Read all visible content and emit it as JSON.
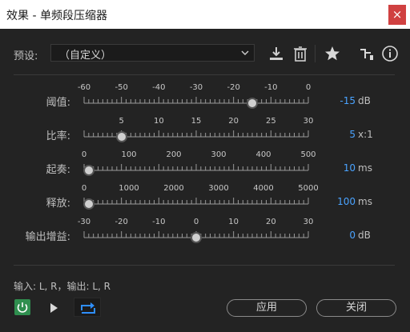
{
  "window": {
    "title": "效果 - 单频段压缩器",
    "close_glyph": "×"
  },
  "preset": {
    "label": "预设:",
    "value": "（自定义）"
  },
  "toolbar": {
    "icons": [
      "download-icon",
      "trash-icon",
      "star-icon",
      "route-icon",
      "info-icon"
    ]
  },
  "controls": [
    {
      "label": "阈值:",
      "ticks": [
        "-60",
        "-50",
        "-40",
        "-30",
        "-20",
        "-10",
        "0"
      ],
      "min": -60,
      "max": 0,
      "value_num": -15,
      "value": "-15",
      "unit": "dB"
    },
    {
      "label": "比率:",
      "ticks": [
        "5",
        "10",
        "15",
        "20",
        "25",
        "30"
      ],
      "min": 0,
      "max": 30,
      "value_num": 5,
      "value": "5",
      "unit": "x:1"
    },
    {
      "label": "起奏:",
      "ticks": [
        "0",
        "100",
        "200",
        "300",
        "400",
        "500"
      ],
      "min": 0,
      "max": 500,
      "value_num": 10,
      "value": "10",
      "unit": "ms"
    },
    {
      "label": "释放:",
      "ticks": [
        "0",
        "1000",
        "2000",
        "3000",
        "4000",
        "5000"
      ],
      "min": 0,
      "max": 5000,
      "value_num": 100,
      "value": "100",
      "unit": "ms"
    },
    {
      "label": "输出增益:",
      "ticks": [
        "-30",
        "-20",
        "-10",
        "0",
        "10",
        "20",
        "30"
      ],
      "min": -30,
      "max": 30,
      "value_num": 0,
      "value": "0",
      "unit": "dB"
    }
  ],
  "io": {
    "text": "输入: L, R，输出: L, R"
  },
  "buttons": {
    "apply": "应用",
    "close": "关闭"
  },
  "colors": {
    "accent": "#4aa3ff",
    "power": "#2f8f4f",
    "close": "#d04141"
  }
}
